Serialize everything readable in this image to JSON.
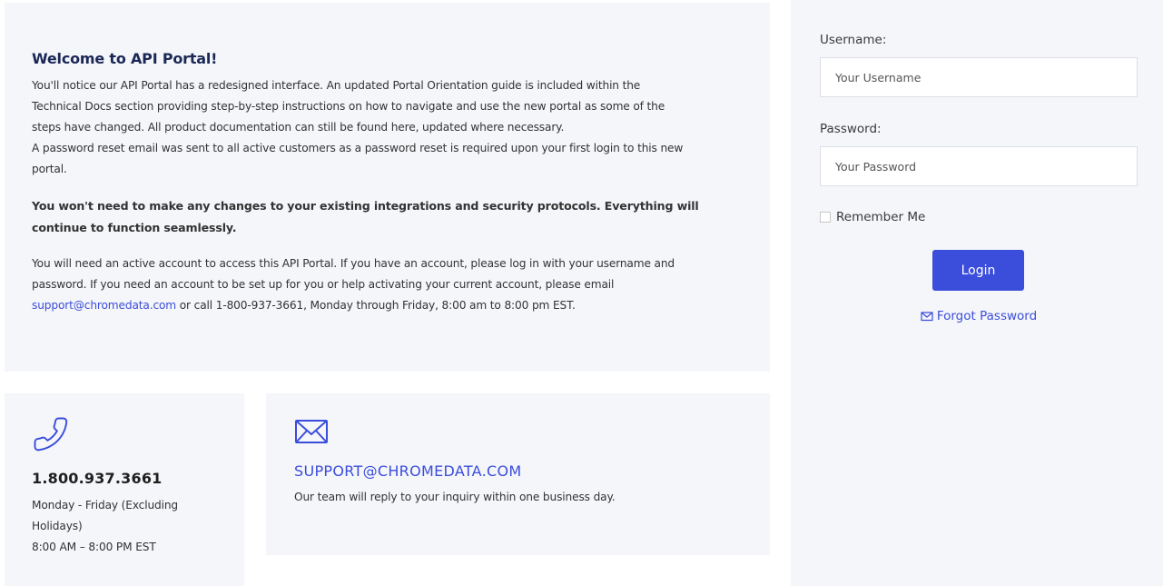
{
  "welcome": {
    "title": "Welcome to API Portal!",
    "intro_line1": "You'll notice our API Portal has a redesigned interface. An updated Portal Orientation guide is included within the",
    "intro_line2": "Technical Docs section providing step-by-step instructions on how to navigate and use the new portal as some of the",
    "intro_line3": "steps have changed. All product documentation can still be found here, updated where necessary.",
    "reset_line1": "A password reset email was sent to all active customers as a password reset is required upon your first login to this new",
    "reset_line2": "portal.",
    "notice_line1": "You won't need to make any changes to your existing integrations and security protocols. Everything will",
    "notice_line2": "continue to function seamlessly.",
    "access_line1": "You will need an active account to access this API Portal. If you have an account, please log in with your username and",
    "access_line2": "password. If you need an account to be set up for you or help activating your current account, please email",
    "access_email_link": "support@chromedata.com",
    "access_line3_rest": " or call 1-800-937-3661, Monday through Friday, 8:00 am to 8:00 pm EST."
  },
  "phone_card": {
    "icon": "phone-icon",
    "number": "1.800.937.3661",
    "hours_line1": "Monday - Friday (Excluding",
    "hours_line2": "Holidays)",
    "hours_line3": "8:00 AM – 8:00 PM EST"
  },
  "email_card": {
    "icon": "envelope-icon",
    "address": "SUPPORT@CHROMEDATA.COM",
    "note": "Our team will reply to your inquiry within one business day."
  },
  "login": {
    "username_label": "Username:",
    "username_placeholder": "Your Username",
    "username_value": "",
    "password_label": "Password:",
    "password_placeholder": "Your Password",
    "password_value": "",
    "remember_label": "Remember Me",
    "remember_checked": false,
    "login_button": "Login",
    "forgot_label": "Forgot Password",
    "forgot_icon": "envelope-icon"
  },
  "colors": {
    "accent": "#3b4ddb",
    "title": "#1b2856",
    "panel_bg": "#f5f6fa"
  }
}
